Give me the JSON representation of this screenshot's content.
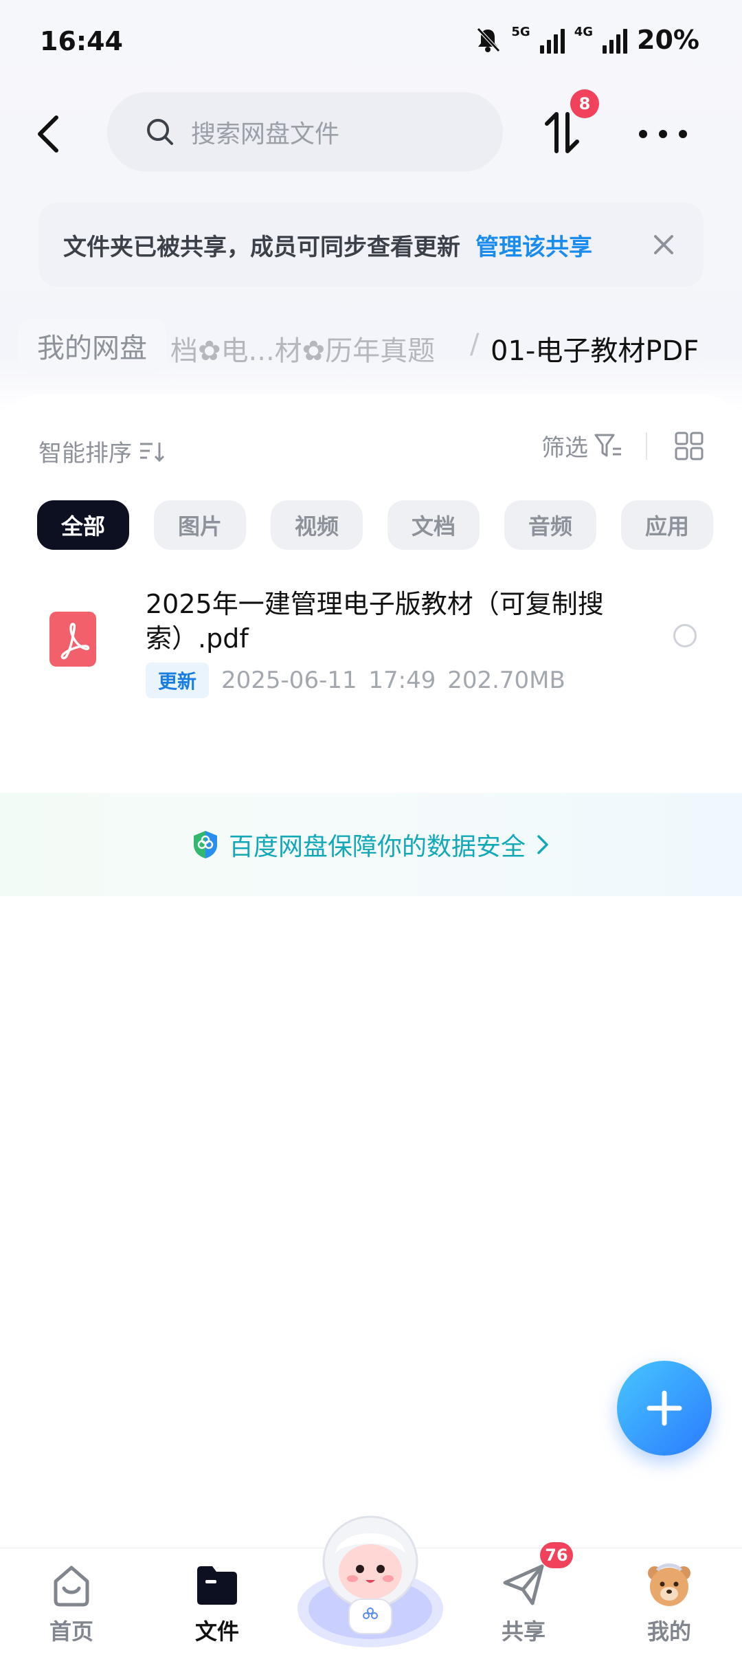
{
  "status_bar": {
    "time": "16:44",
    "network_1": "5G",
    "network_2": "4G",
    "battery": "20%",
    "icons": [
      "mute-icon",
      "signal-icon",
      "signal-icon"
    ]
  },
  "header": {
    "search_placeholder": "搜索网盘文件",
    "transfer_badge": "8"
  },
  "notice": {
    "text": "文件夹已被共享，成员可同步查看更新",
    "link": "管理该共享"
  },
  "breadcrumb": {
    "root": "我的网盘",
    "middle": "档✿电...材✿历年真题",
    "separator": "/",
    "current": "01-电子教材PDF"
  },
  "toolbar": {
    "sort_label": "智能排序",
    "filter_label": "筛选"
  },
  "chips": [
    "全部",
    "图片",
    "视频",
    "文档",
    "音频",
    "应用"
  ],
  "file": {
    "name": "2025年一建管理电子版教材（可复制搜索）.pdf",
    "tag": "更新",
    "meta": "2025-06-11  17:49  202.70MB"
  },
  "safety": {
    "text": "百度网盘保障你的数据安全"
  },
  "bottom_nav": {
    "home": "首页",
    "files": "文件",
    "share": "共享",
    "mine": "我的",
    "share_badge": "76"
  },
  "colors": {
    "accent": "#1a8cf0",
    "badge": "#f2415a",
    "chip_active": "#0c1020",
    "fab_start": "#47c6ff",
    "fab_end": "#2b7bff"
  }
}
